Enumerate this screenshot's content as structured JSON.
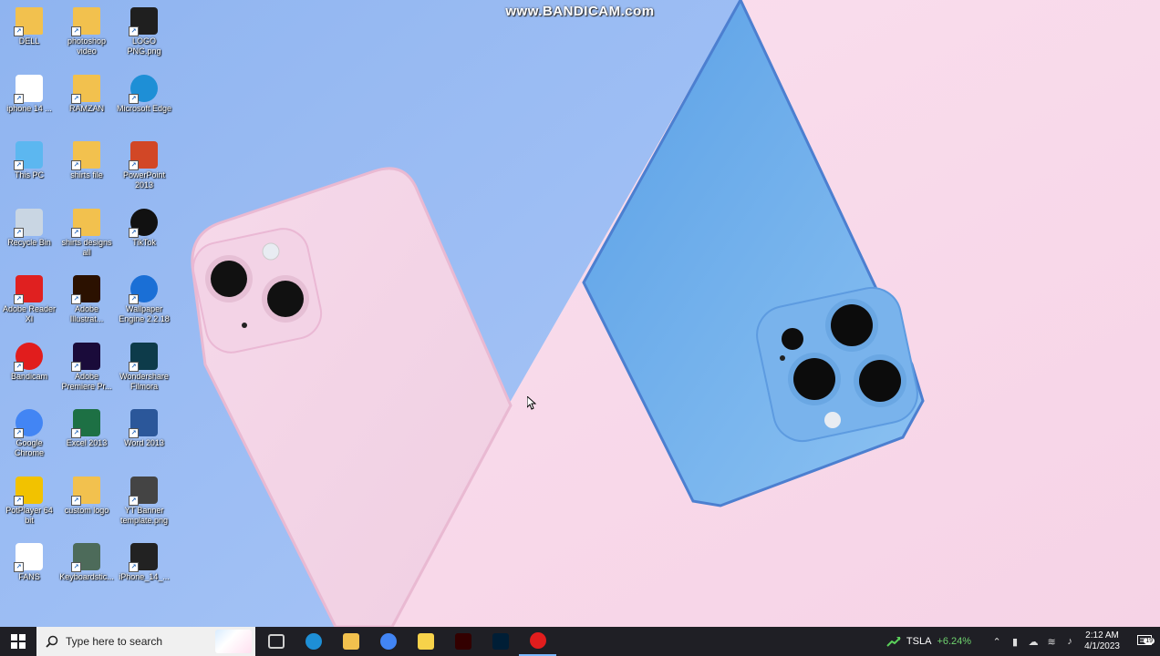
{
  "watermark": "www.BANDICAM.com",
  "desktop_icons": [
    {
      "label": "DELL",
      "icon": "user-folder-icon",
      "color": "#f2c14e"
    },
    {
      "label": "photoshop video",
      "icon": "folder-icon",
      "color": "#f2c14e"
    },
    {
      "label": "LOGO PNG.png",
      "icon": "image-file-icon",
      "color": "#1f1f1f"
    },
    {
      "label": "iphone 14 ...",
      "icon": "image-file-icon",
      "color": "#ffffff"
    },
    {
      "label": "RAMZAN",
      "icon": "folder-icon",
      "color": "#f2c14e"
    },
    {
      "label": "Microsoft Edge",
      "icon": "edge-icon",
      "color": "#1e8fd6"
    },
    {
      "label": "This PC",
      "icon": "computer-icon",
      "color": "#5cb7f0"
    },
    {
      "label": "shirts file",
      "icon": "folder-icon",
      "color": "#f2c14e"
    },
    {
      "label": "PowerPoint 2013",
      "icon": "powerpoint-icon",
      "color": "#d24726"
    },
    {
      "label": "Recycle Bin",
      "icon": "recycle-bin-icon",
      "color": "#c9d6e3"
    },
    {
      "label": "shirts designs all",
      "icon": "folder-icon",
      "color": "#f2c14e"
    },
    {
      "label": "TikTok",
      "icon": "tiktok-icon",
      "color": "#111111"
    },
    {
      "label": "Adobe Reader XI",
      "icon": "acrobat-icon",
      "color": "#e02020"
    },
    {
      "label": "Adobe Illustrat...",
      "icon": "illustrator-icon",
      "color": "#2b1100"
    },
    {
      "label": "Wallpaper Engine 2.2.18",
      "icon": "wallpaper-engine-icon",
      "color": "#1a6fd6"
    },
    {
      "label": "Bandicam",
      "icon": "bandicam-icon",
      "color": "#e11d1d"
    },
    {
      "label": "Adobe Premiere Pr...",
      "icon": "premiere-icon",
      "color": "#1a0b3a"
    },
    {
      "label": "Wondershare Filmora",
      "icon": "filmora-icon",
      "color": "#0d3b4a"
    },
    {
      "label": "Google Chrome",
      "icon": "chrome-icon",
      "color": "#4285f4"
    },
    {
      "label": "Excel 2013",
      "icon": "excel-icon",
      "color": "#1d7044"
    },
    {
      "label": "Word 2013",
      "icon": "word-icon",
      "color": "#2b579a"
    },
    {
      "label": "PotPlayer 64 bit",
      "icon": "potplayer-icon",
      "color": "#f2c200"
    },
    {
      "label": "custom logo",
      "icon": "folder-icon",
      "color": "#f2c14e"
    },
    {
      "label": "YT Banner template.png",
      "icon": "image-file-icon",
      "color": "#444444"
    },
    {
      "label": "FANS",
      "icon": "document-icon",
      "color": "#ffffff"
    },
    {
      "label": "Keyboardstic...",
      "icon": "keyboard-icon",
      "color": "#4d6b5a"
    },
    {
      "label": "iPhone_14_...",
      "icon": "image-file-icon",
      "color": "#222222"
    }
  ],
  "taskbar": {
    "search_placeholder": "Type here to search",
    "apps": [
      {
        "name": "task-view-icon",
        "active": false
      },
      {
        "name": "edge-icon",
        "active": false
      },
      {
        "name": "file-explorer-icon",
        "active": false
      },
      {
        "name": "chrome-icon",
        "active": false
      },
      {
        "name": "sticky-notes-icon",
        "active": false
      },
      {
        "name": "illustrator-icon",
        "active": false
      },
      {
        "name": "photoshop-icon",
        "active": false
      },
      {
        "name": "bandicam-icon",
        "active": true
      }
    ],
    "stock_symbol": "TSLA",
    "stock_change": "+6.24%",
    "time": "2:12 AM",
    "date": "4/1/2023",
    "notification_count": "19"
  }
}
